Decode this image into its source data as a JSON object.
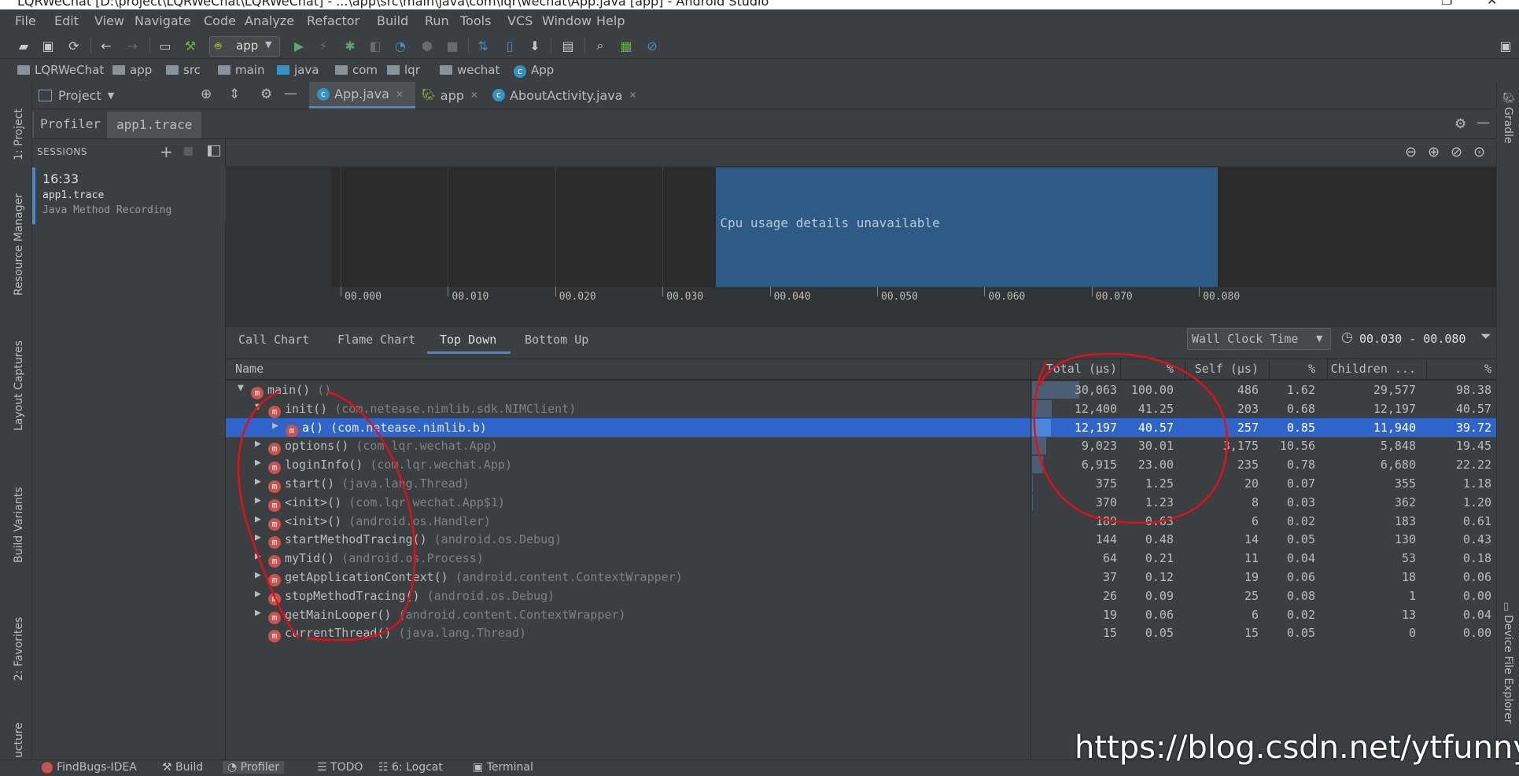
{
  "window": {
    "title": "LQRWeChat [D:\\project\\LQRWeChat\\LQRWeChat] - ...\\app\\src\\main\\java\\com\\lqr\\wechat\\App.java [app] - Android Studio"
  },
  "menu": [
    "File",
    "Edit",
    "View",
    "Navigate",
    "Code",
    "Analyze",
    "Refactor",
    "Build",
    "Run",
    "Tools",
    "VCS",
    "Window",
    "Help"
  ],
  "toolbar": {
    "run_config": "app"
  },
  "breadcrumb": [
    "LQRWeChat",
    "app",
    "src",
    "main",
    "java",
    "com",
    "lqr",
    "wechat",
    "App"
  ],
  "left_stripe": [
    "1: Project",
    "Resource Manager",
    "Layout Captures",
    "Build Variants",
    "2: Favorites",
    "ucture"
  ],
  "right_stripe": [
    "Gradle",
    "Device File Explorer"
  ],
  "project_panel": {
    "label": "Project"
  },
  "editor_tabs": [
    {
      "label": "App.java"
    },
    {
      "label": "app"
    },
    {
      "label": "AboutActivity.java"
    }
  ],
  "profiler": {
    "tabs": [
      "Profiler",
      "app1.trace"
    ]
  },
  "sessions": {
    "header": "SESSIONS",
    "item": {
      "time": "16:33",
      "name": "app1.trace",
      "type": "Java Method Recording"
    }
  },
  "timeline": {
    "message": "Cpu usage details unavailable",
    "ticks": [
      "00.000",
      "00.010",
      "00.020",
      "00.030",
      "00.040",
      "00.050",
      "00.060",
      "00.070",
      "00.080"
    ],
    "selection_start_fraction": 0.3727,
    "selection_end_fraction": 0.8585
  },
  "analysis": {
    "tabs": [
      "Call Chart",
      "Flame Chart",
      "Top Down",
      "Bottom Up"
    ],
    "active_tab": "Top Down",
    "clock_select": "Wall Clock Time",
    "range": "00.030 - 00.080",
    "columns": [
      "Name",
      "Total (μs)",
      "%",
      "Self (μs)",
      "%",
      "Children ...",
      "%"
    ],
    "rows": [
      {
        "arrow": "▼",
        "indent": 0,
        "method": "main()",
        "cls": "()",
        "total": "30,063",
        "tpct": "100.00",
        "self": "486",
        "spct": "1.62",
        "children": "29,577",
        "cpct": "98.38"
      },
      {
        "arrow": "▼",
        "indent": 1,
        "method": "init()",
        "cls": "(com.netease.nimlib.sdk.NIMClient)",
        "total": "12,400",
        "tpct": "41.25",
        "self": "203",
        "spct": "0.68",
        "children": "12,197",
        "cpct": "40.57"
      },
      {
        "arrow": "▶",
        "indent": 2,
        "method": "a()",
        "cls": "(com.netease.nimlib.b)",
        "total": "12,197",
        "tpct": "40.57",
        "self": "257",
        "spct": "0.85",
        "children": "11,940",
        "cpct": "39.72",
        "selected": true
      },
      {
        "arrow": "▶",
        "indent": 1,
        "method": "options()",
        "cls": "(com.lqr.wechat.App)",
        "total": "9,023",
        "tpct": "30.01",
        "self": "3,175",
        "spct": "10.56",
        "children": "5,848",
        "cpct": "19.45"
      },
      {
        "arrow": "▶",
        "indent": 1,
        "method": "loginInfo()",
        "cls": "(com.lqr.wechat.App)",
        "total": "6,915",
        "tpct": "23.00",
        "self": "235",
        "spct": "0.78",
        "children": "6,680",
        "cpct": "22.22"
      },
      {
        "arrow": "▶",
        "indent": 1,
        "method": "start()",
        "cls": "(java.lang.Thread)",
        "total": "375",
        "tpct": "1.25",
        "self": "20",
        "spct": "0.07",
        "children": "355",
        "cpct": "1.18"
      },
      {
        "arrow": "▶",
        "indent": 1,
        "method": "<init>()",
        "cls": "(com.lqr.wechat.App$1)",
        "total": "370",
        "tpct": "1.23",
        "self": "8",
        "spct": "0.03",
        "children": "362",
        "cpct": "1.20"
      },
      {
        "arrow": "▶",
        "indent": 1,
        "method": "<init>()",
        "cls": "(android.os.Handler)",
        "total": "189",
        "tpct": "0.63",
        "self": "6",
        "spct": "0.02",
        "children": "183",
        "cpct": "0.61"
      },
      {
        "arrow": "▶",
        "indent": 1,
        "method": "startMethodTracing()",
        "cls": "(android.os.Debug)",
        "total": "144",
        "tpct": "0.48",
        "self": "14",
        "spct": "0.05",
        "children": "130",
        "cpct": "0.43"
      },
      {
        "arrow": "▶",
        "indent": 1,
        "method": "myTid()",
        "cls": "(android.os.Process)",
        "total": "64",
        "tpct": "0.21",
        "self": "11",
        "spct": "0.04",
        "children": "53",
        "cpct": "0.18"
      },
      {
        "arrow": "▶",
        "indent": 1,
        "method": "getApplicationContext()",
        "cls": "(android.content.ContextWrapper)",
        "total": "37",
        "tpct": "0.12",
        "self": "19",
        "spct": "0.06",
        "children": "18",
        "cpct": "0.06"
      },
      {
        "arrow": "▶",
        "indent": 1,
        "method": "stopMethodTracing()",
        "cls": "(android.os.Debug)",
        "total": "26",
        "tpct": "0.09",
        "self": "25",
        "spct": "0.08",
        "children": "1",
        "cpct": "0.00"
      },
      {
        "arrow": "▶",
        "indent": 1,
        "method": "getMainLooper()",
        "cls": "(android.content.ContextWrapper)",
        "total": "19",
        "tpct": "0.06",
        "self": "6",
        "spct": "0.02",
        "children": "13",
        "cpct": "0.04"
      },
      {
        "arrow": "",
        "indent": 1,
        "method": "currentThread()",
        "cls": "(java.lang.Thread)",
        "total": "15",
        "tpct": "0.05",
        "self": "15",
        "spct": "0.05",
        "children": "0",
        "cpct": "0.00"
      }
    ]
  },
  "bottom_tools": [
    {
      "label": "FindBugs-IDEA"
    },
    {
      "label": "Build"
    },
    {
      "label": "Profiler"
    },
    {
      "label": "TODO"
    },
    {
      "label": "6: Logcat"
    },
    {
      "label": "Terminal"
    }
  ],
  "watermark": "https://blog.csdn.net/ytfunnysite",
  "colors": {
    "bg": "#3c3f41",
    "selected_row": "#2f65ca",
    "timeline_selection": "#2e5a86",
    "annotation": "#e0101a"
  }
}
